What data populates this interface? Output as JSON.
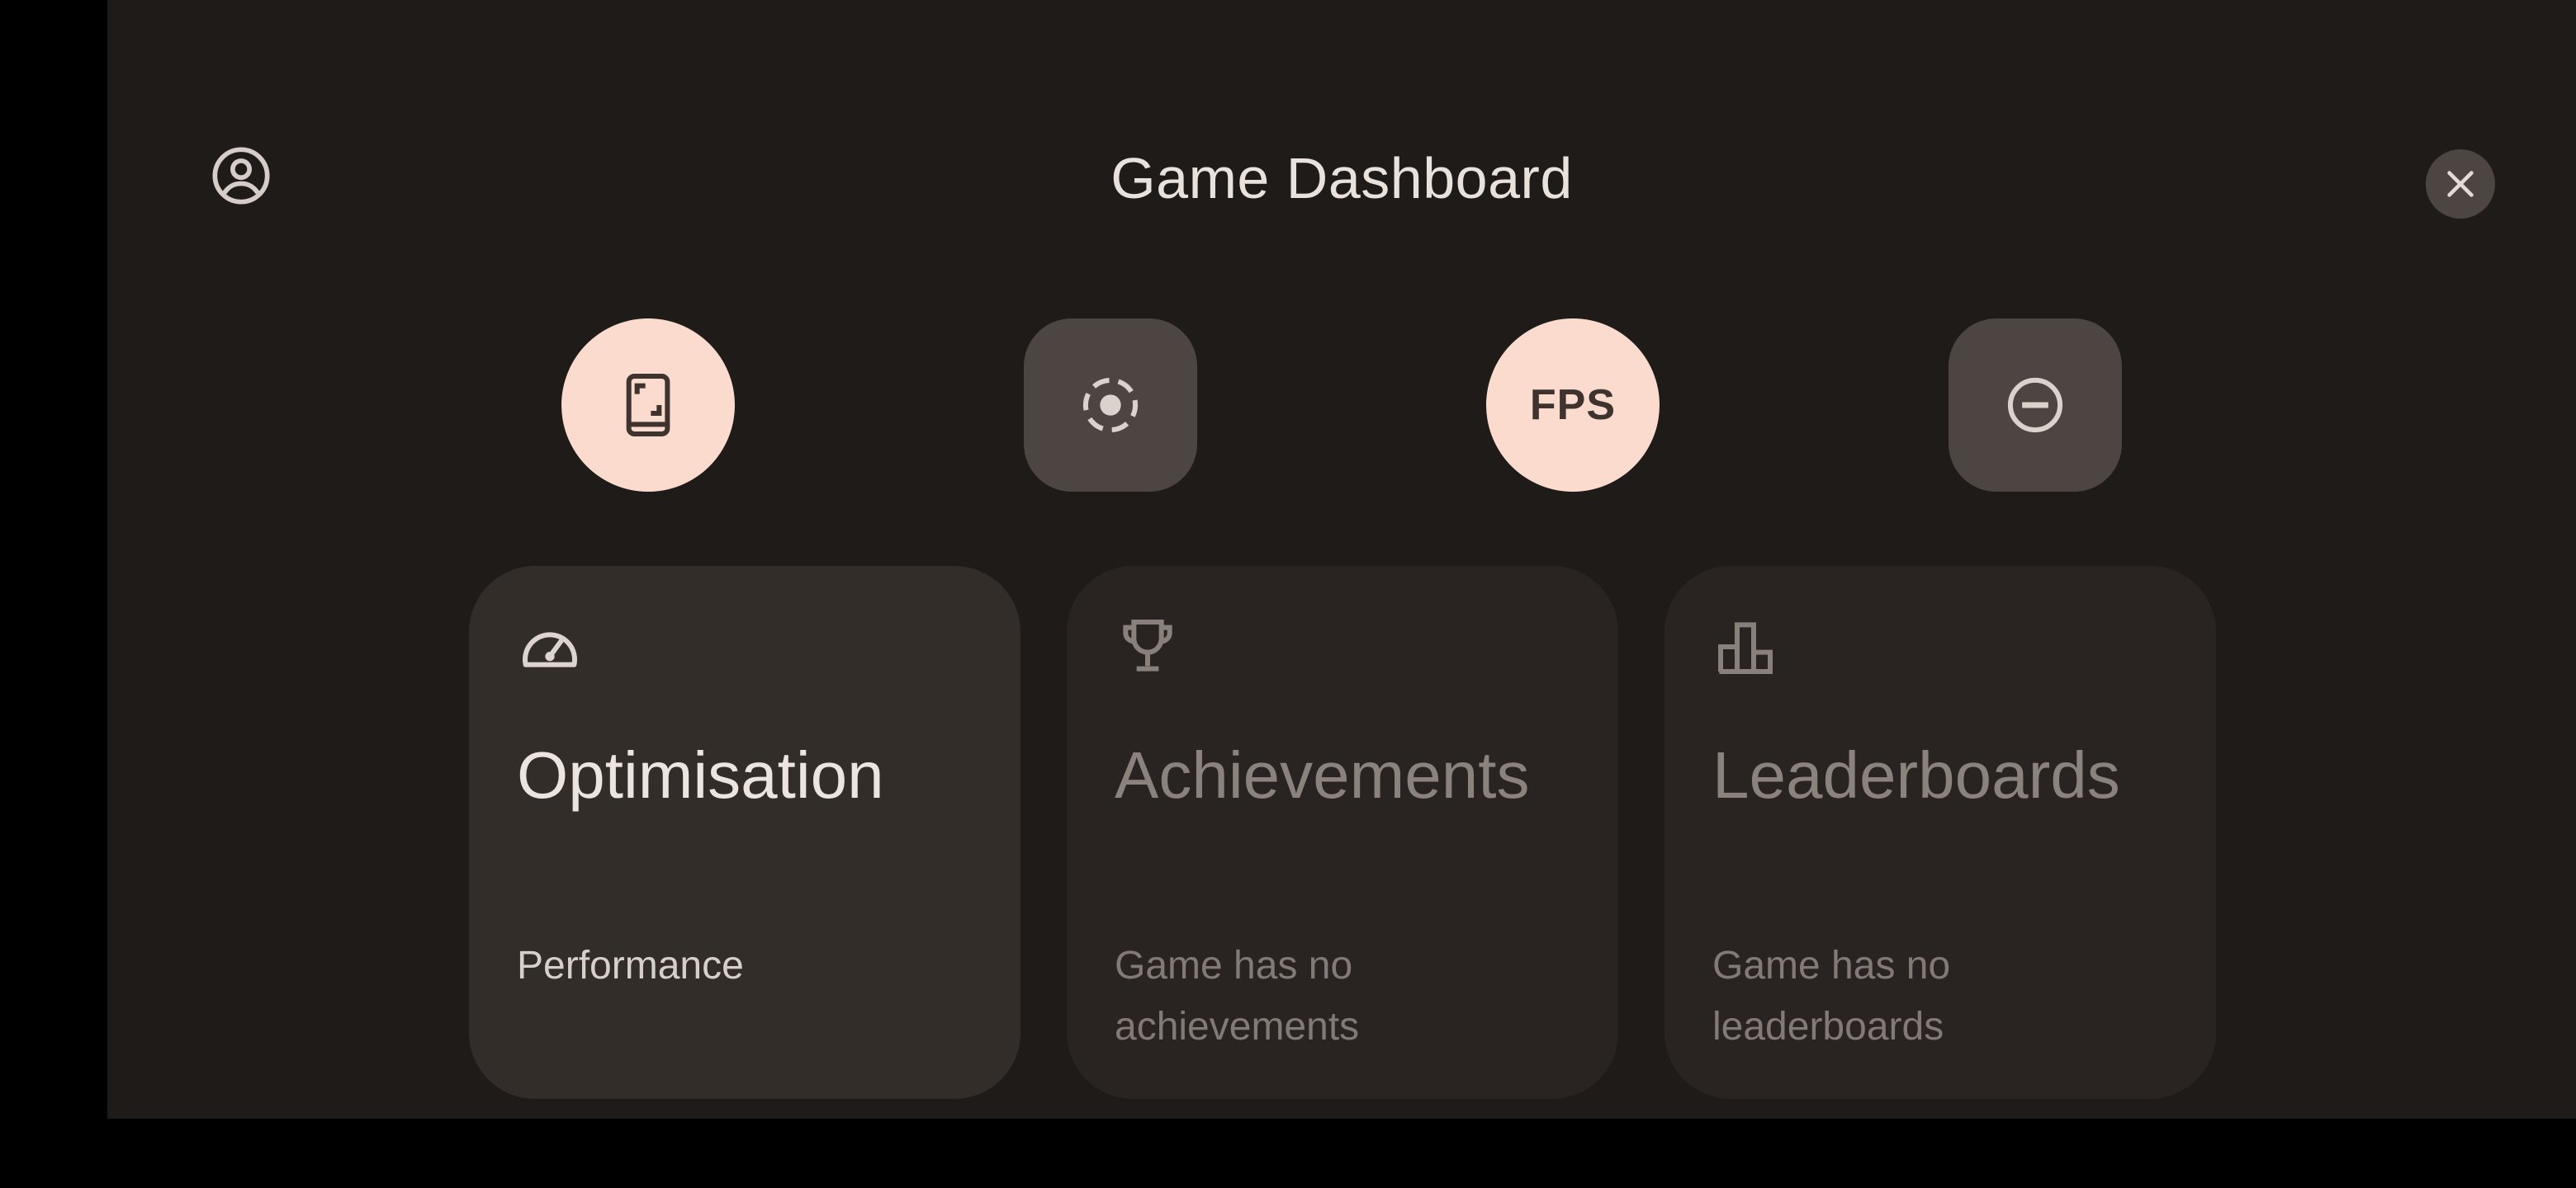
{
  "header": {
    "title": "Game Dashboard",
    "account_icon": "account-circle-icon",
    "close_icon": "close-icon"
  },
  "quick_tiles": [
    {
      "name": "screenshot",
      "icon": "phone-screenshot-icon",
      "state": "on"
    },
    {
      "name": "record",
      "icon": "screen-record-icon",
      "state": "off"
    },
    {
      "name": "fps",
      "label": "FPS",
      "state": "on"
    },
    {
      "name": "do-not-disturb",
      "icon": "do-not-disturb-icon",
      "state": "off"
    }
  ],
  "cards": [
    {
      "title": "Optimisation",
      "subtitle": "Performance",
      "icon": "speedometer-icon",
      "enabled": true
    },
    {
      "title": "Achievements",
      "subtitle": "Game has no achievements",
      "icon": "trophy-icon",
      "enabled": false
    },
    {
      "title": "Leaderboards",
      "subtitle": "Game has no leaderboards",
      "icon": "leaderboard-icon",
      "enabled": false
    }
  ],
  "colors": {
    "background": "#1f1b19",
    "tile_on": "#fadbcd",
    "tile_off": "#4d4541",
    "card_active": "#332d2a",
    "card_inactive": "#292422"
  }
}
